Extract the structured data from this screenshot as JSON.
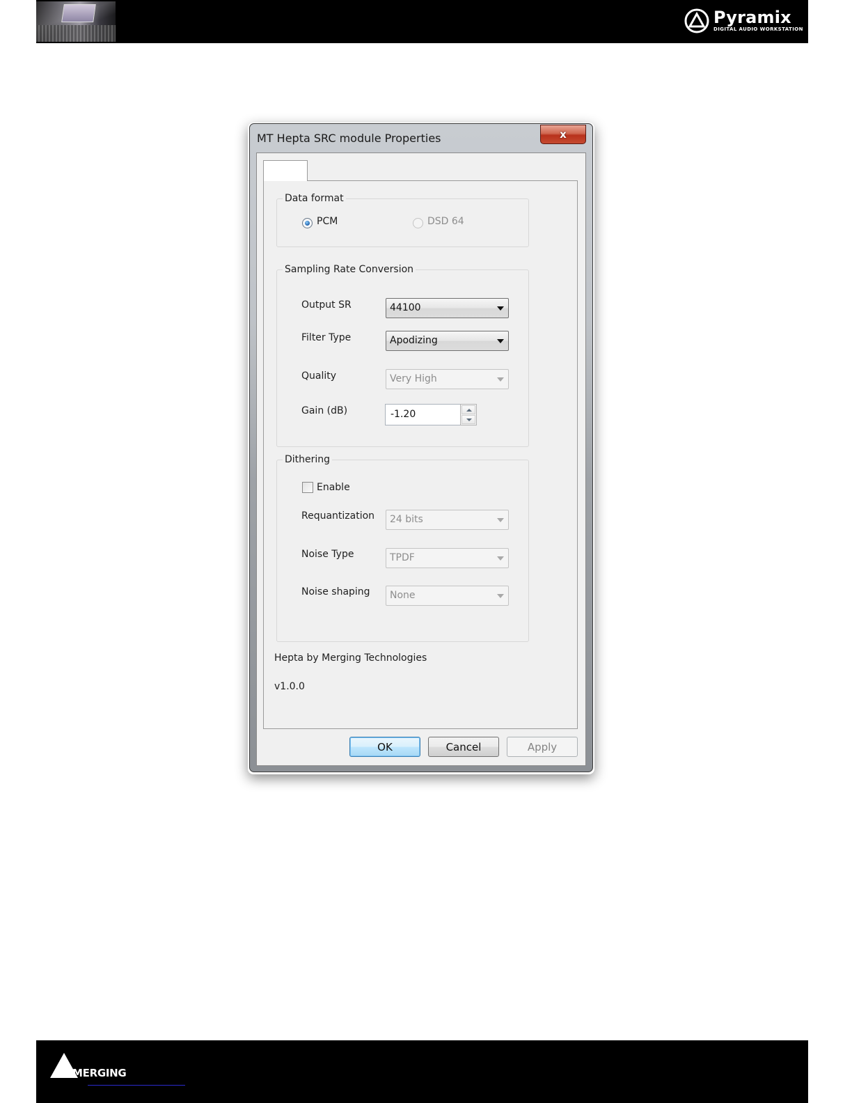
{
  "header": {
    "brand_name": "Pyramix",
    "brand_tagline": "DIGITAL AUDIO WORKSTATION"
  },
  "footer": {
    "brand_name": "MERGING"
  },
  "dialog": {
    "title": "MT Hepta SRC module Properties",
    "close_glyph": "x",
    "data_format": {
      "label": "Data format",
      "options": [
        {
          "label": "PCM",
          "checked": true,
          "enabled": true
        },
        {
          "label": "DSD 64",
          "checked": false,
          "enabled": false
        }
      ]
    },
    "src": {
      "label": "Sampling Rate Conversion",
      "output_sr": {
        "label": "Output SR",
        "value": "44100"
      },
      "filter_type": {
        "label": "Filter Type",
        "value": "Apodizing"
      },
      "quality": {
        "label": "Quality",
        "value": "Very High"
      },
      "gain": {
        "label": "Gain (dB)",
        "value": "-1.20"
      }
    },
    "dithering": {
      "label": "Dithering",
      "enable": {
        "label": "Enable",
        "checked": false
      },
      "requantization": {
        "label": "Requantization",
        "value": "24 bits"
      },
      "noise_type": {
        "label": "Noise Type",
        "value": "TPDF"
      },
      "noise_shaping": {
        "label": "Noise shaping",
        "value": "None"
      }
    },
    "credits": "Hepta by Merging Technologies",
    "version": "v1.0.0",
    "buttons": {
      "ok": "OK",
      "cancel": "Cancel",
      "apply": "Apply"
    }
  }
}
